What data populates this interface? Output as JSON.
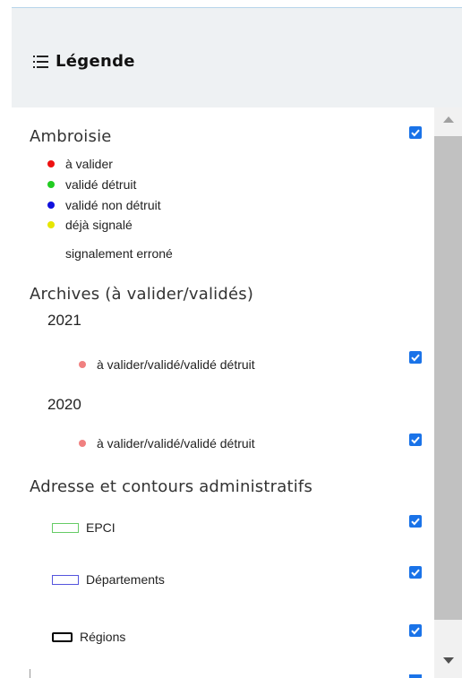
{
  "header": {
    "title": "Légende",
    "icon": "list-icon"
  },
  "groups": {
    "ambroisie": {
      "title": "Ambroisie",
      "checked": true,
      "items": [
        {
          "label": "à valider",
          "color": "#ee1111"
        },
        {
          "label": "validé détruit",
          "color": "#22cc22"
        },
        {
          "label": "validé non détruit",
          "color": "#1111dd"
        },
        {
          "label": "déjà signalé",
          "color": "#e6e600"
        },
        {
          "label": "signalement erroné",
          "color": "#ffffff"
        }
      ]
    },
    "archives": {
      "title": "Archives (à valider/validés)",
      "years": [
        {
          "year": "2021",
          "label": "à valider/validé/validé détruit",
          "color": "#f08080",
          "checked": true
        },
        {
          "year": "2020",
          "label": "à valider/validé/validé détruit",
          "color": "#f08080",
          "checked": true
        }
      ]
    },
    "admin": {
      "title": "Adresse et contours administratifs",
      "layers": [
        {
          "label": "EPCI",
          "color": "#66cc66",
          "checked": true
        },
        {
          "label": "Départements",
          "color": "#5555dd",
          "checked": true
        },
        {
          "label": "Régions",
          "color": "#000000",
          "checked": true
        }
      ]
    }
  },
  "colors": {
    "accent": "#1a73e8",
    "header_bg": "#eef1f3"
  }
}
